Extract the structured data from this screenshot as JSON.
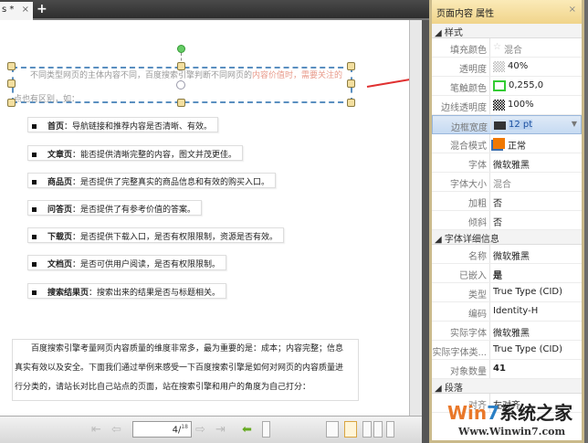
{
  "tabs": {
    "active_label": "s *",
    "close": "×",
    "new": "+"
  },
  "selection": {
    "text_line1_normal": "不同类型网页的主体内容不同，百度搜索引擎判断不同网页的",
    "text_line1_highlight": "内容价值时，需要关注的",
    "text_line2": "点也有区别，如："
  },
  "bullets": [
    {
      "key": "首页",
      "text": "：导航链接和推荐内容是否清晰、有效。"
    },
    {
      "key": "文章页",
      "text": "：能否提供清晰完整的内容，图文并茂更佳。"
    },
    {
      "key": "商品页",
      "text": "：是否提供了完整真实的商品信息和有效的购买入口。"
    },
    {
      "key": "问答页",
      "text": "：是否提供了有参考价值的答案。"
    },
    {
      "key": "下载页",
      "text": "：是否提供下载入口，是否有权限限制，资源是否有效。"
    },
    {
      "key": "文档页",
      "text": "：是否可供用户阅读，是否有权限限制。"
    },
    {
      "key": "搜索结果页",
      "text": "：搜索出来的结果是否与标题相关。"
    }
  ],
  "paragraph": [
    "百度搜索引擎考量网页内容质量的维度非常多，最为重要的是：成本；内容完整；信息",
    "真实有效以及安全。下面我们通过举例来感受一下百度搜索引擎是如何对网页的内容质量进",
    "行分类的，请站长对比自己站点的页面，站在搜索引擎和用户的角度为自己打分："
  ],
  "toolbar": {
    "page_current": "4/",
    "page_total": "18"
  },
  "panel": {
    "title": "页面内容 属性",
    "close": "×",
    "sections": [
      {
        "title": "样式",
        "rows": [
          {
            "label": "填充颜色",
            "value": "混合"
          },
          {
            "label": "透明度",
            "value": "40%"
          },
          {
            "label": "笔触颜色",
            "value": "0,255,0"
          },
          {
            "label": "边线透明度",
            "value": "100%"
          },
          {
            "label": "边框宽度",
            "value": "12 pt"
          },
          {
            "label": "混合模式",
            "value": "正常"
          },
          {
            "label": "字体",
            "value": "微软雅黑"
          },
          {
            "label": "字体大小",
            "value": "混合"
          },
          {
            "label": "加粗",
            "value": "否"
          },
          {
            "label": "倾斜",
            "value": "否"
          }
        ]
      },
      {
        "title": "字体详细信息",
        "rows": [
          {
            "label": "名称",
            "value": "微软雅黑"
          },
          {
            "label": "已嵌入",
            "value": "是"
          },
          {
            "label": "类型",
            "value": "True Type (CID)"
          },
          {
            "label": "编码",
            "value": "Identity-H"
          },
          {
            "label": "实际字体",
            "value": "微软雅黑"
          },
          {
            "label": "实际字体类...",
            "value": "True Type (CID)"
          },
          {
            "label": "对象数量",
            "value": "41"
          }
        ]
      },
      {
        "title": "段落",
        "rows": [
          {
            "label": "对齐",
            "value": "左对齐"
          }
        ]
      }
    ]
  },
  "watermark": {
    "brand_a": "Win",
    "brand_b": "7",
    "brand_c": "系统之家",
    "url": "Www.Winwin7.com"
  },
  "colors": {
    "stroke": "#00ff00",
    "blend": "#f07800",
    "accent": "#e03030"
  }
}
